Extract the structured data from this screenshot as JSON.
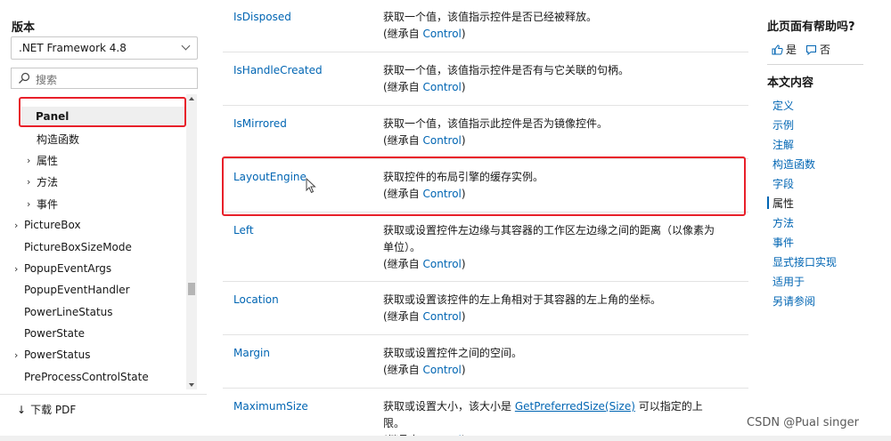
{
  "sidebar": {
    "version_label": "版本",
    "version_value": ".NET Framework 4.8",
    "filter_placeholder": "搜索",
    "tree": [
      {
        "label": "Panel",
        "arrow": "",
        "indent": 1,
        "selected": true,
        "bold": true
      },
      {
        "label": "构造函数",
        "arrow": "",
        "indent": 1
      },
      {
        "label": "属性",
        "arrow": "›",
        "indent": 1
      },
      {
        "label": "方法",
        "arrow": "›",
        "indent": 1
      },
      {
        "label": "事件",
        "arrow": "›",
        "indent": 1
      },
      {
        "label": "PictureBox",
        "arrow": "›",
        "indent": 0
      },
      {
        "label": "PictureBoxSizeMode",
        "arrow": "",
        "indent": 0
      },
      {
        "label": "PopupEventArgs",
        "arrow": "›",
        "indent": 0
      },
      {
        "label": "PopupEventHandler",
        "arrow": "",
        "indent": 0
      },
      {
        "label": "PowerLineStatus",
        "arrow": "",
        "indent": 0
      },
      {
        "label": "PowerState",
        "arrow": "",
        "indent": 0
      },
      {
        "label": "PowerStatus",
        "arrow": "›",
        "indent": 0
      },
      {
        "label": "PreProcessControlState",
        "arrow": "",
        "indent": 0
      }
    ],
    "download_label": "下载 PDF"
  },
  "properties": {
    "inherited_prefix": "(继承自 ",
    "inherited_class": "Control",
    "inherited_suffix": ")",
    "rows": [
      {
        "name": "IsDisposed",
        "desc": "获取一个值，该值指示控件是否已经被释放。"
      },
      {
        "name": "IsHandleCreated",
        "desc": "获取一个值，该值指示控件是否有与它关联的句柄。"
      },
      {
        "name": "IsMirrored",
        "desc": "获取一个值，该值指示此控件是否为镜像控件。"
      },
      {
        "name": "LayoutEngine",
        "desc": "获取控件的布局引擎的缓存实例。"
      },
      {
        "name": "Left",
        "desc": "获取或设置控件左边缘与其容器的工作区左边缘之间的距离（以像素为单位）。"
      },
      {
        "name": "Location",
        "desc": "获取或设置该控件的左上角相对于其容器的左上角的坐标。"
      },
      {
        "name": "Margin",
        "desc": "获取或设置控件之间的空间。"
      },
      {
        "name": "MaximumSize",
        "desc_before": "获取或设置大小，该大小是 ",
        "desc_link": "GetPreferredSize(Size)",
        "desc_after": " 可以指定的上限。"
      }
    ]
  },
  "right": {
    "helpful_title": "此页面有帮助吗?",
    "yes_label": "是",
    "no_label": "否",
    "toc_title": "本文内容",
    "toc": [
      "定义",
      "示例",
      "注解",
      "构造函数",
      "字段",
      "属性",
      "方法",
      "事件",
      "显式接口实现",
      "适用于",
      "另请参阅"
    ],
    "toc_active": "属性"
  },
  "watermark": "CSDN @Pual singer",
  "colors": {
    "link": "#0065b3",
    "highlight": "#e8202a",
    "text": "#171717"
  }
}
